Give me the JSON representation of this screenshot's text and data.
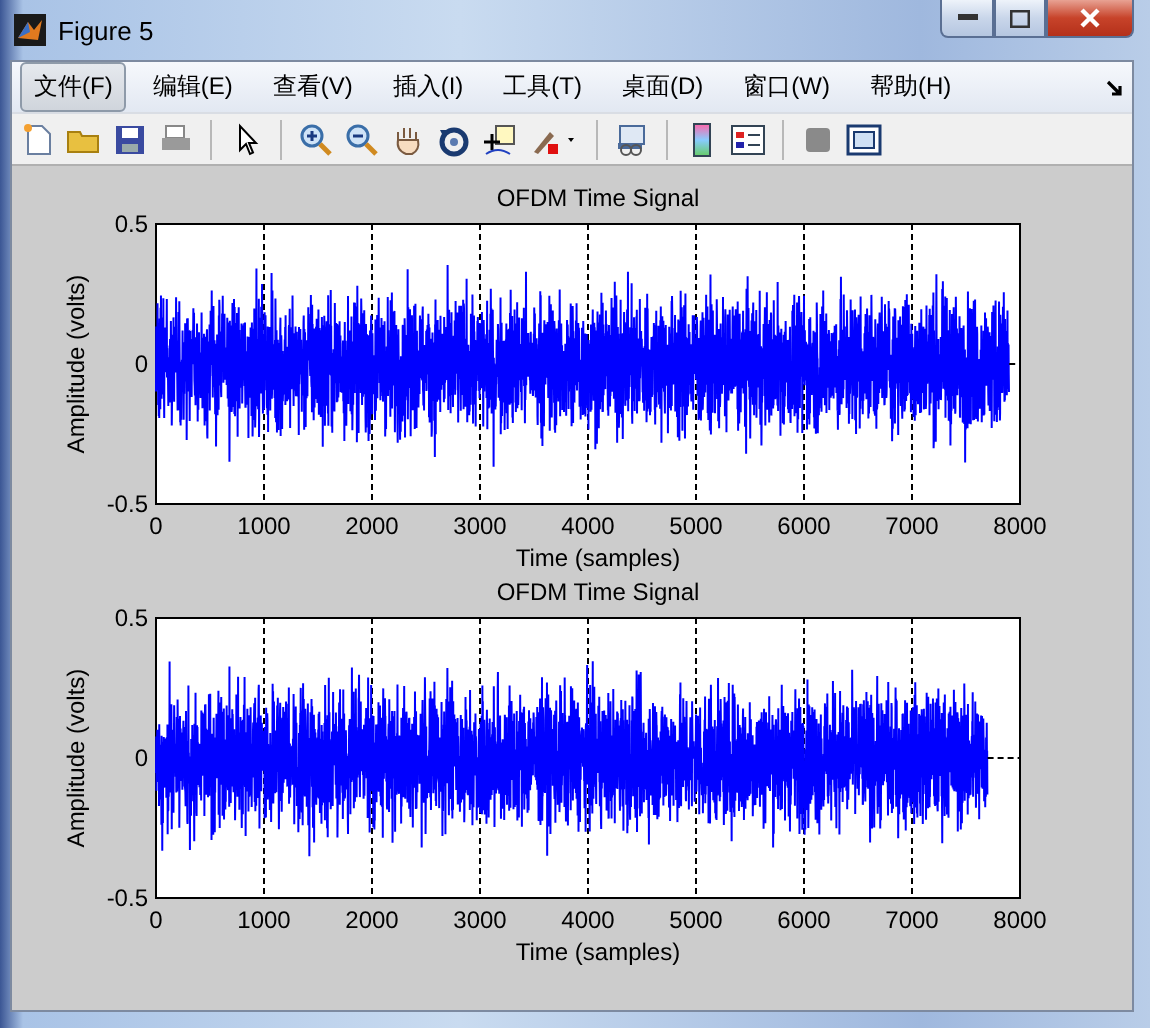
{
  "window": {
    "title": "Figure 5"
  },
  "menu": [
    {
      "label": "文件(F)",
      "selected": true
    },
    {
      "label": "编辑(E)",
      "selected": false
    },
    {
      "label": "查看(V)",
      "selected": false
    },
    {
      "label": "插入(I)",
      "selected": false
    },
    {
      "label": "工具(T)",
      "selected": false
    },
    {
      "label": "桌面(D)",
      "selected": false
    },
    {
      "label": "窗口(W)",
      "selected": false
    },
    {
      "label": "帮助(H)",
      "selected": false
    }
  ],
  "plots": [
    {
      "title": "OFDM Time Signal",
      "xlabel": "Time (samples)",
      "ylabel": "Amplitude (volts)",
      "xticks": [
        "0",
        "1000",
        "2000",
        "3000",
        "4000",
        "5000",
        "6000",
        "7000",
        "8000"
      ],
      "yticks": [
        "0.5",
        "0",
        "-0.5"
      ]
    },
    {
      "title": "OFDM Time Signal",
      "xlabel": "Time (samples)",
      "ylabel": "Amplitude (volts)",
      "xticks": [
        "0",
        "1000",
        "2000",
        "3000",
        "4000",
        "5000",
        "6000",
        "7000",
        "8000"
      ],
      "yticks": [
        "0.5",
        "0",
        "-0.5"
      ]
    }
  ]
}
